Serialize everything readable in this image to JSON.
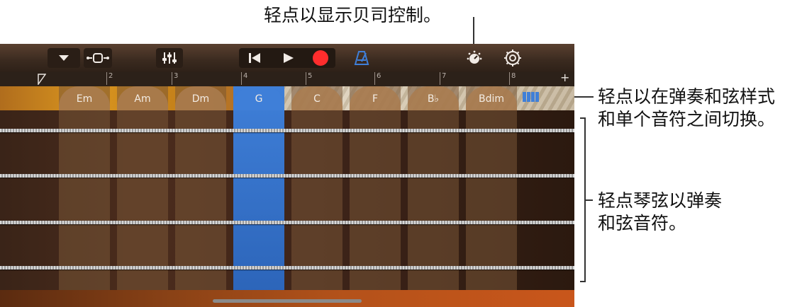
{
  "callouts": {
    "bass": "轻点以显示贝司控制。",
    "toggle": "轻点以在弹奏和弦样式\n和单个音符之间切换。",
    "strings": "轻点琴弦以弹奏\n和弦音符。"
  },
  "ruler": {
    "marks": [
      "2",
      "3",
      "4",
      "5",
      "6",
      "7",
      "8"
    ],
    "add": "+"
  },
  "chords": [
    {
      "label": "Em"
    },
    {
      "label": "Am"
    },
    {
      "label": "Dm"
    },
    {
      "label": "G",
      "active": true
    },
    {
      "label": "C"
    },
    {
      "label": "F"
    },
    {
      "label": "B♭"
    },
    {
      "label": "Bdim"
    }
  ],
  "colors": {
    "accent_blue": "#3f7fd8",
    "record_red": "#ff2d2d"
  },
  "icons": {
    "browser": "chevron-down-icon",
    "tracks": "tracks-view-icon",
    "mixer": "mixer-sliders-icon",
    "rewind": "rewind-icon",
    "play": "play-icon",
    "record": "record-icon",
    "metronome": "metronome-icon",
    "bass_controls": "bass-controls-knob-icon",
    "settings": "settings-gear-icon",
    "toggle": "chord-strips-toggle-icon"
  }
}
